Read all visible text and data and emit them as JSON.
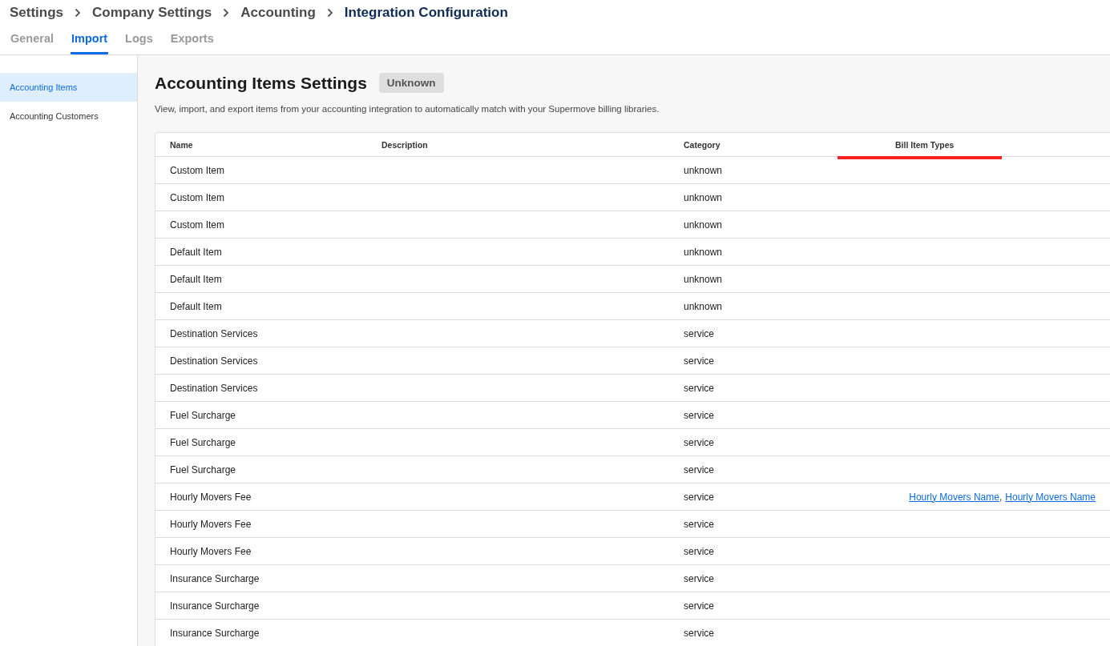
{
  "breadcrumb": [
    {
      "label": "Settings",
      "current": false
    },
    {
      "label": "Company Settings",
      "current": false
    },
    {
      "label": "Accounting",
      "current": false
    },
    {
      "label": "Integration Configuration",
      "current": true
    }
  ],
  "tabs": [
    {
      "label": "General",
      "selected": false
    },
    {
      "label": "Import",
      "selected": true
    },
    {
      "label": "Logs",
      "selected": false
    },
    {
      "label": "Exports",
      "selected": false
    }
  ],
  "sidebar": {
    "items": [
      {
        "label": "Accounting Items",
        "selected": true
      },
      {
        "label": "Accounting Customers",
        "selected": false
      }
    ]
  },
  "page": {
    "title": "Accounting Items Settings",
    "badge": "Unknown",
    "description": "View, import, and export items from your accounting integration to automatically match with your Supermove billing libraries."
  },
  "table": {
    "columns": [
      "Name",
      "Description",
      "Category",
      "Bill Item Types"
    ],
    "rows": [
      {
        "name": "Custom Item",
        "category": "unknown"
      },
      {
        "name": "Custom Item",
        "category": "unknown"
      },
      {
        "name": "Custom Item",
        "category": "unknown"
      },
      {
        "name": "Default Item",
        "category": "unknown"
      },
      {
        "name": "Default Item",
        "category": "unknown"
      },
      {
        "name": "Default Item",
        "category": "unknown"
      },
      {
        "name": "Destination Services",
        "category": "service"
      },
      {
        "name": "Destination Services",
        "category": "service"
      },
      {
        "name": "Destination Services",
        "category": "service"
      },
      {
        "name": "Fuel Surcharge",
        "category": "service"
      },
      {
        "name": "Fuel Surcharge",
        "category": "service"
      },
      {
        "name": "Fuel Surcharge",
        "category": "service"
      },
      {
        "name": "Hourly Movers Fee",
        "category": "service",
        "bill_item_types": [
          "Hourly Movers Name",
          "Hourly Movers Name"
        ],
        "bill_item_separator": ","
      },
      {
        "name": "Hourly Movers Fee",
        "category": "service"
      },
      {
        "name": "Hourly Movers Fee",
        "category": "service"
      },
      {
        "name": "Insurance Surcharge",
        "category": "service"
      },
      {
        "name": "Insurance Surcharge",
        "category": "service"
      },
      {
        "name": "Insurance Surcharge",
        "category": "service"
      }
    ]
  }
}
